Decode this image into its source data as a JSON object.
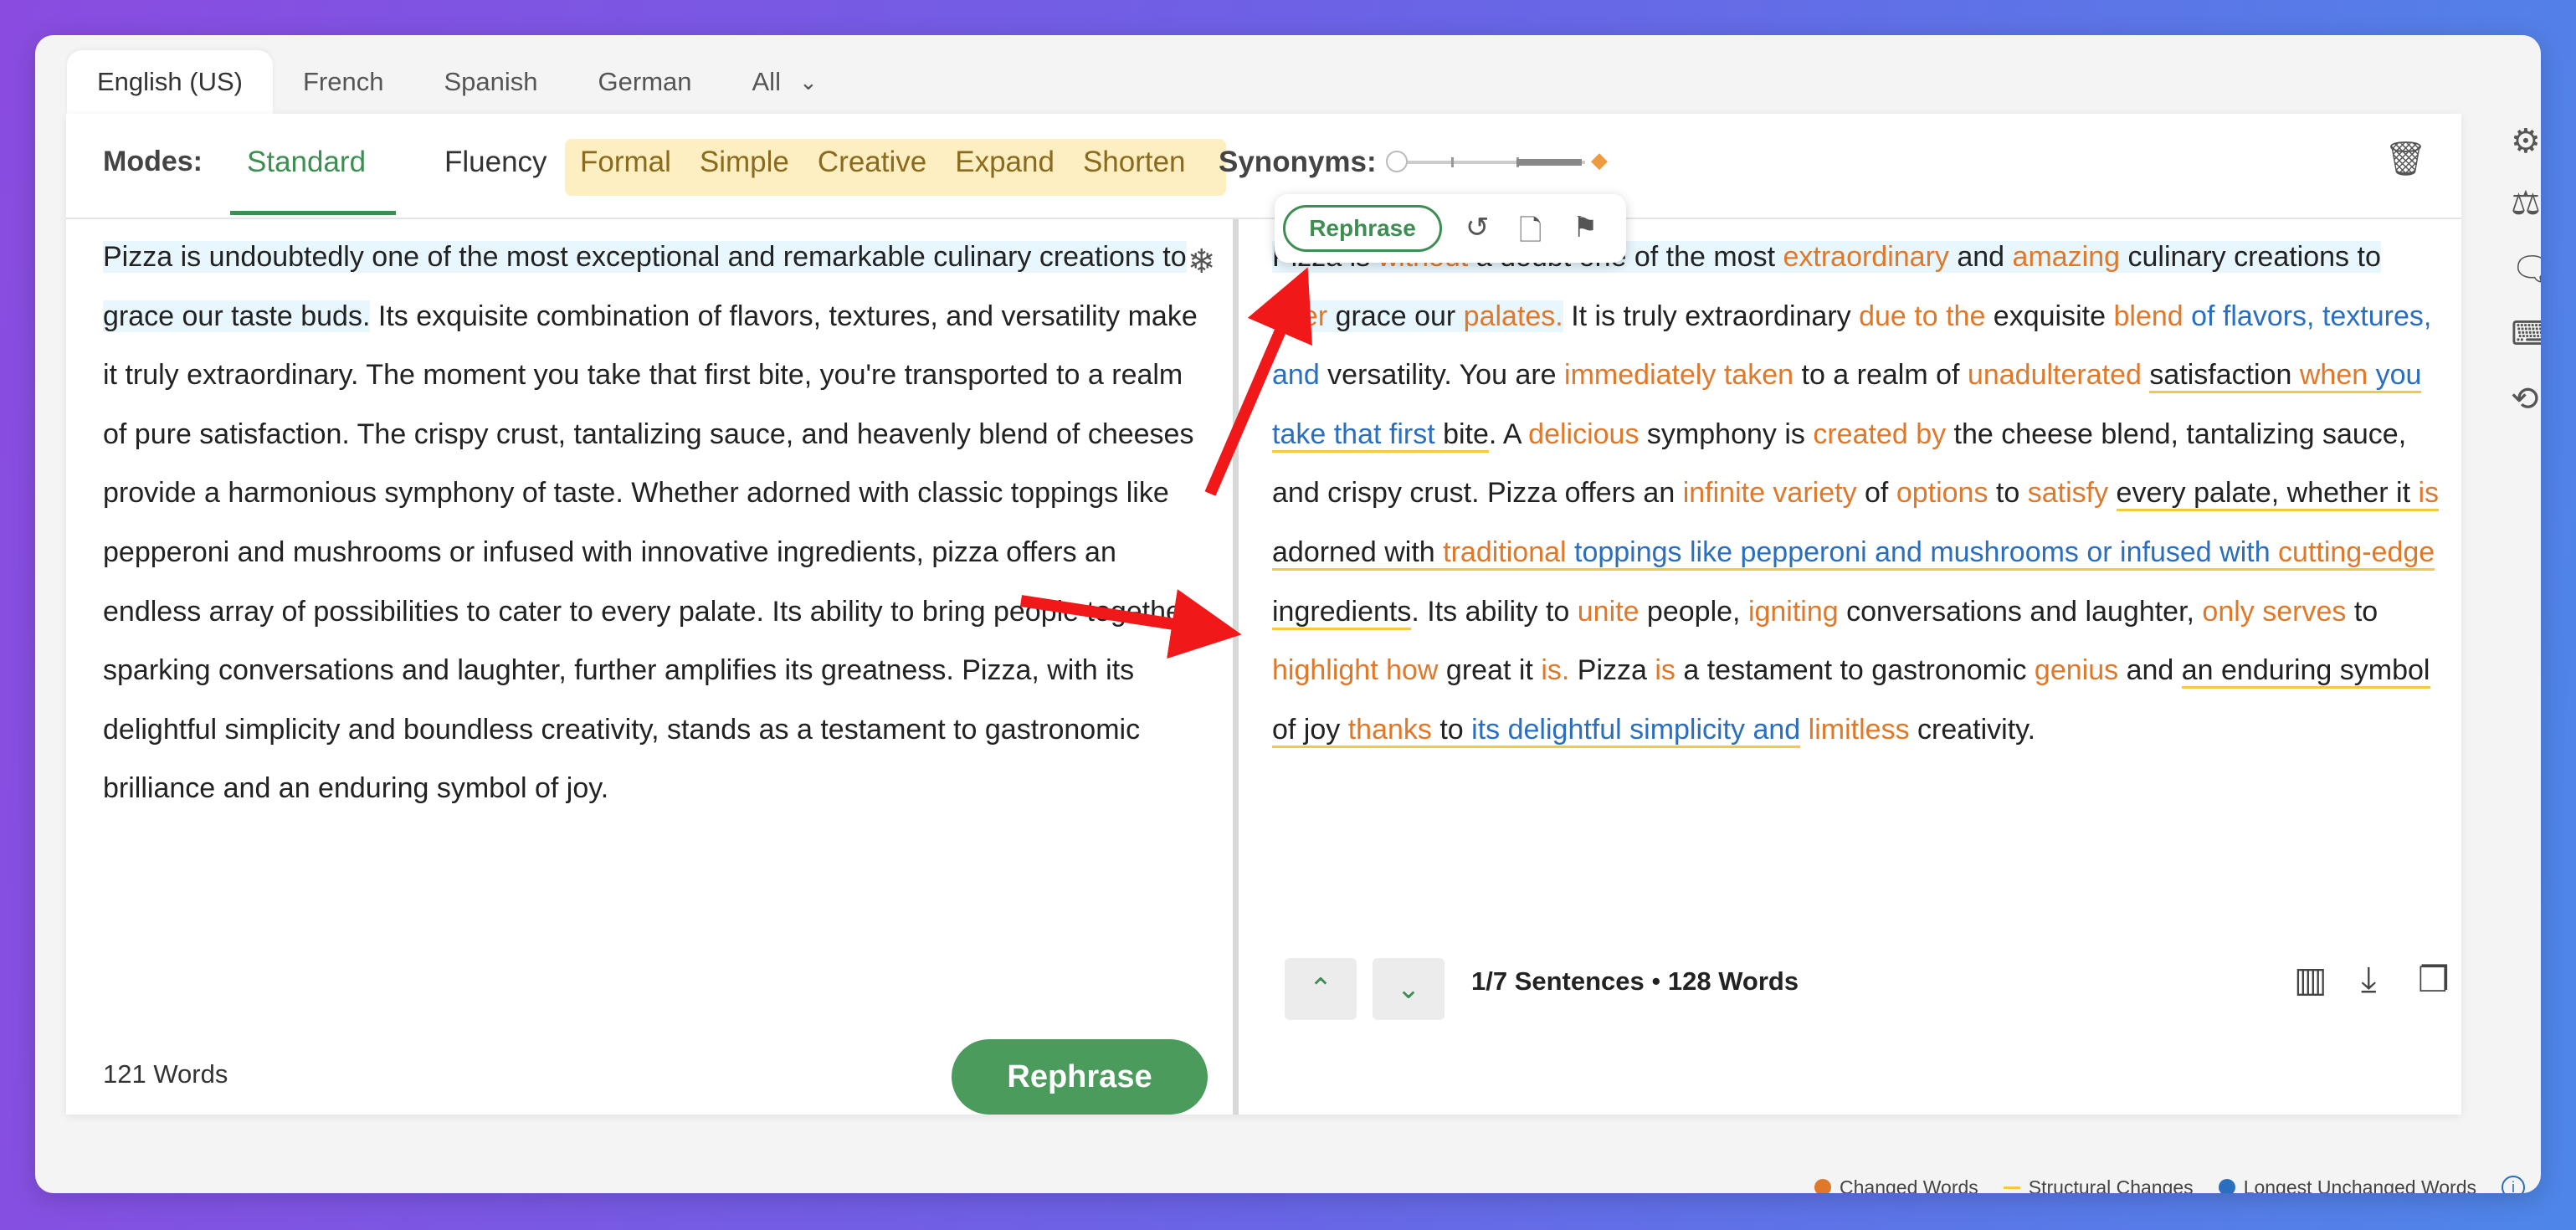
{
  "languages": {
    "tabs": [
      "English (US)",
      "French",
      "Spanish",
      "German",
      "All"
    ]
  },
  "modes": {
    "label": "Modes:",
    "standard": "Standard",
    "fluency": "Fluency",
    "premium": [
      "Formal",
      "Simple",
      "Creative",
      "Expand",
      "Shorten"
    ],
    "synonyms_label": "Synonyms:"
  },
  "input": {
    "text_highlighted": "Pizza is undoubtedly one of the most exceptional and remarkable culinary creations to grace our taste buds.",
    "text_rest": " Its exquisite combination of flavors, textures, and versatility make it truly extraordinary. The moment you take that first bite, you're transported to a realm of pure satisfaction. The crispy crust, tantalizing sauce, and heavenly blend of cheeses provide a harmonious symphony of taste. Whether adorned with classic toppings like pepperoni and mushrooms or infused with innovative ingredients, pizza offers an endless array of possibilities to cater to every palate. Its ability to bring people together, sparking conversations and laughter, further amplifies its greatness. Pizza, with its delightful simplicity and boundless creativity, stands as a testament to gastronomic brilliance and an enduring symbol of joy.",
    "word_count": "121 Words",
    "rephrase_button": "Rephrase"
  },
  "toolbar": {
    "rephrase": "Rephrase"
  },
  "output": {
    "segments": [
      {
        "t": "Pizza is ",
        "k": "n",
        "hl": true
      },
      {
        "t": "without",
        "k": "c",
        "hl": true
      },
      {
        "t": " a doubt one of the most ",
        "k": "n",
        "hl": true
      },
      {
        "t": "extraordinary",
        "k": "c",
        "hl": true
      },
      {
        "t": " and ",
        "k": "n",
        "hl": true
      },
      {
        "t": "amazing",
        "k": "c",
        "hl": true
      },
      {
        "t": " culinary creations to ",
        "k": "n",
        "hl": true
      },
      {
        "t": "ever",
        "k": "c",
        "hl": true
      },
      {
        "t": " grace our ",
        "k": "n",
        "hl": true
      },
      {
        "t": "palates.",
        "k": "c",
        "hl": true
      },
      {
        "t": " It is truly extraordinary ",
        "k": "n"
      },
      {
        "t": "due to the",
        "k": "c"
      },
      {
        "t": " exquisite ",
        "k": "n"
      },
      {
        "t": "blend",
        "k": "c"
      },
      {
        "t": " of flavors, textures, and",
        "k": "u"
      },
      {
        "t": " versatility. You are ",
        "k": "n"
      },
      {
        "t": "immediately taken",
        "k": "c"
      },
      {
        "t": " to a realm of ",
        "k": "n"
      },
      {
        "t": "unadulterated",
        "k": "c"
      },
      {
        "t": " ",
        "k": "n"
      },
      {
        "t": "satisfaction ",
        "k": "n",
        "s": true
      },
      {
        "t": "when",
        "k": "c",
        "s": true
      },
      {
        "t": " you take that first",
        "k": "u",
        "s": true
      },
      {
        "t": " bite",
        "k": "n",
        "s": true
      },
      {
        "t": ". A ",
        "k": "n"
      },
      {
        "t": "delicious",
        "k": "c"
      },
      {
        "t": " symphony is ",
        "k": "n"
      },
      {
        "t": "created by",
        "k": "c"
      },
      {
        "t": " the cheese blend, tantalizing sauce, and crispy crust. Pizza offers an ",
        "k": "n"
      },
      {
        "t": "infinite variety",
        "k": "c"
      },
      {
        "t": " of ",
        "k": "n"
      },
      {
        "t": "options",
        "k": "c"
      },
      {
        "t": " to ",
        "k": "n"
      },
      {
        "t": "satisfy",
        "k": "c"
      },
      {
        "t": " ",
        "k": "n"
      },
      {
        "t": "every palate, whether it ",
        "k": "n",
        "s": true
      },
      {
        "t": "is",
        "k": "c",
        "s": true
      },
      {
        "t": " adorned with ",
        "k": "n",
        "s": true
      },
      {
        "t": "traditional",
        "k": "c",
        "s": true
      },
      {
        "t": " toppings like pepperoni and mushrooms or infused with ",
        "k": "u",
        "s": true
      },
      {
        "t": "cutting-edge",
        "k": "c",
        "s": true
      },
      {
        "t": " ingredients",
        "k": "n",
        "s": true
      },
      {
        "t": ". Its ability to ",
        "k": "n"
      },
      {
        "t": "unite",
        "k": "c"
      },
      {
        "t": " people, ",
        "k": "n"
      },
      {
        "t": "igniting",
        "k": "c"
      },
      {
        "t": " conversations and laughter, ",
        "k": "n"
      },
      {
        "t": "only serves",
        "k": "c"
      },
      {
        "t": " to ",
        "k": "n"
      },
      {
        "t": "highlight how",
        "k": "c"
      },
      {
        "t": " great it ",
        "k": "n"
      },
      {
        "t": "is.",
        "k": "c"
      },
      {
        "t": " Pizza ",
        "k": "n"
      },
      {
        "t": "is",
        "k": "c"
      },
      {
        "t": " a testament to gastronomic ",
        "k": "n"
      },
      {
        "t": "genius",
        "k": "c"
      },
      {
        "t": " and ",
        "k": "n"
      },
      {
        "t": "an enduring symbol of joy ",
        "k": "n",
        "s": true
      },
      {
        "t": "thanks",
        "k": "c",
        "s": true
      },
      {
        "t": " to ",
        "k": "n",
        "s": true
      },
      {
        "t": "its delightful simplicity and",
        "k": "u",
        "s": true
      },
      {
        "t": " ",
        "k": "n"
      },
      {
        "t": "limitless",
        "k": "c"
      },
      {
        "t": " creativity.",
        "k": "n"
      }
    ],
    "sentences": "1/7 Sentences",
    "word_count": "128 Words"
  },
  "legend": {
    "changed": "Changed Words",
    "structural": "Structural Changes",
    "unchanged": "Longest Unchanged Words",
    "colors": {
      "changed": "#e0782a",
      "structural": "#f5c842",
      "unchanged": "#2a6fbf"
    }
  },
  "side_icons": [
    "gear-icon",
    "compare-icon",
    "comment-icon",
    "keyboard-icon",
    "history-icon"
  ]
}
